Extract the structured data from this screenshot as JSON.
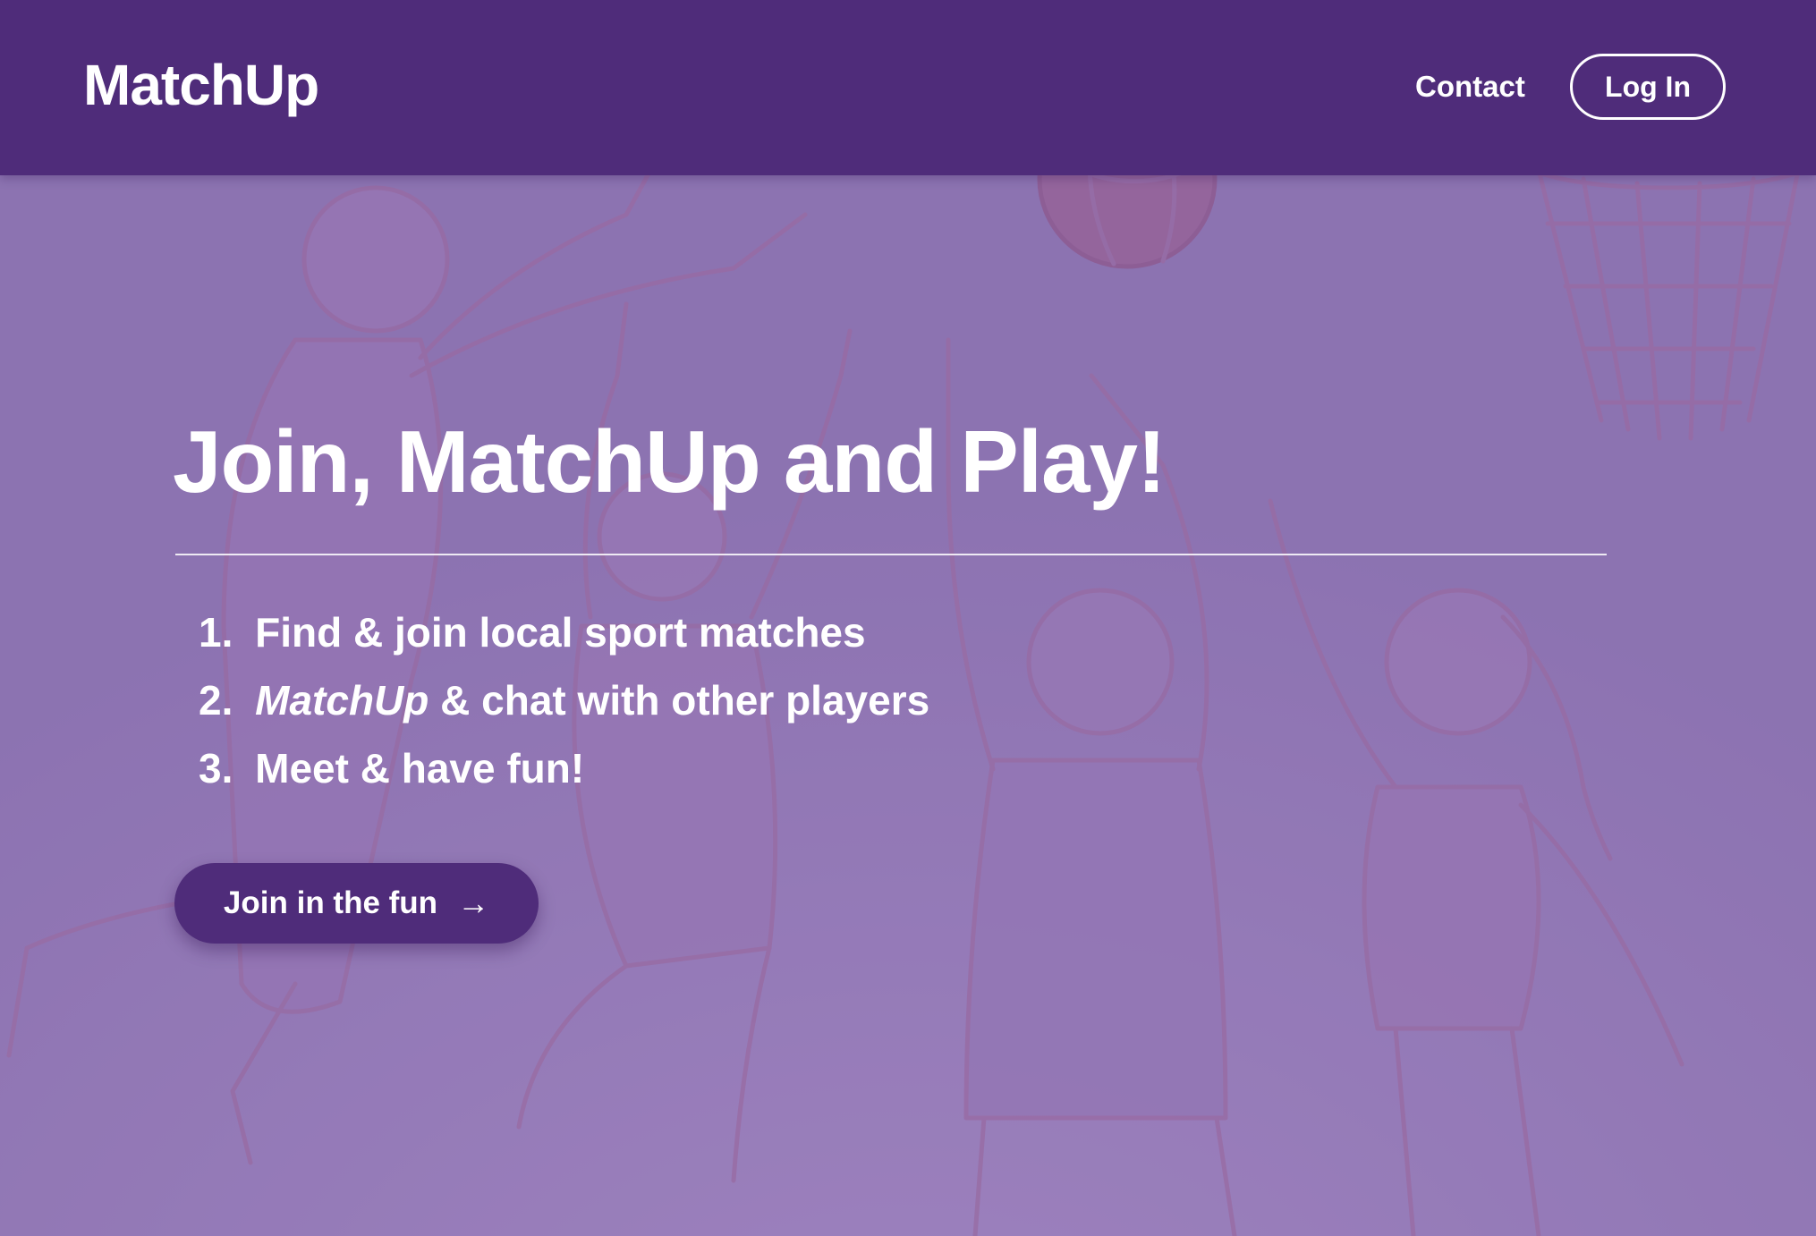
{
  "navbar": {
    "brand": "MatchUp",
    "contact_label": "Contact",
    "login_label": "Log In"
  },
  "hero": {
    "headline": "Join, MatchUp and Play!",
    "steps": [
      {
        "number": "1.",
        "text": "Find & join local sport matches"
      },
      {
        "number": "2.",
        "emphasis": "MatchUp",
        "text": " & chat with other players"
      },
      {
        "number": "3.",
        "text": "Meet & have fun!"
      }
    ],
    "cta_label": "Join in the fun",
    "cta_icon": "arrow-right-icon",
    "background": "basketball-players-illustration"
  },
  "colors": {
    "navbar": "#4f2c7a",
    "hero_overlay": "#8f78b3",
    "text": "#ffffff",
    "cta": "#4f2c7a"
  }
}
